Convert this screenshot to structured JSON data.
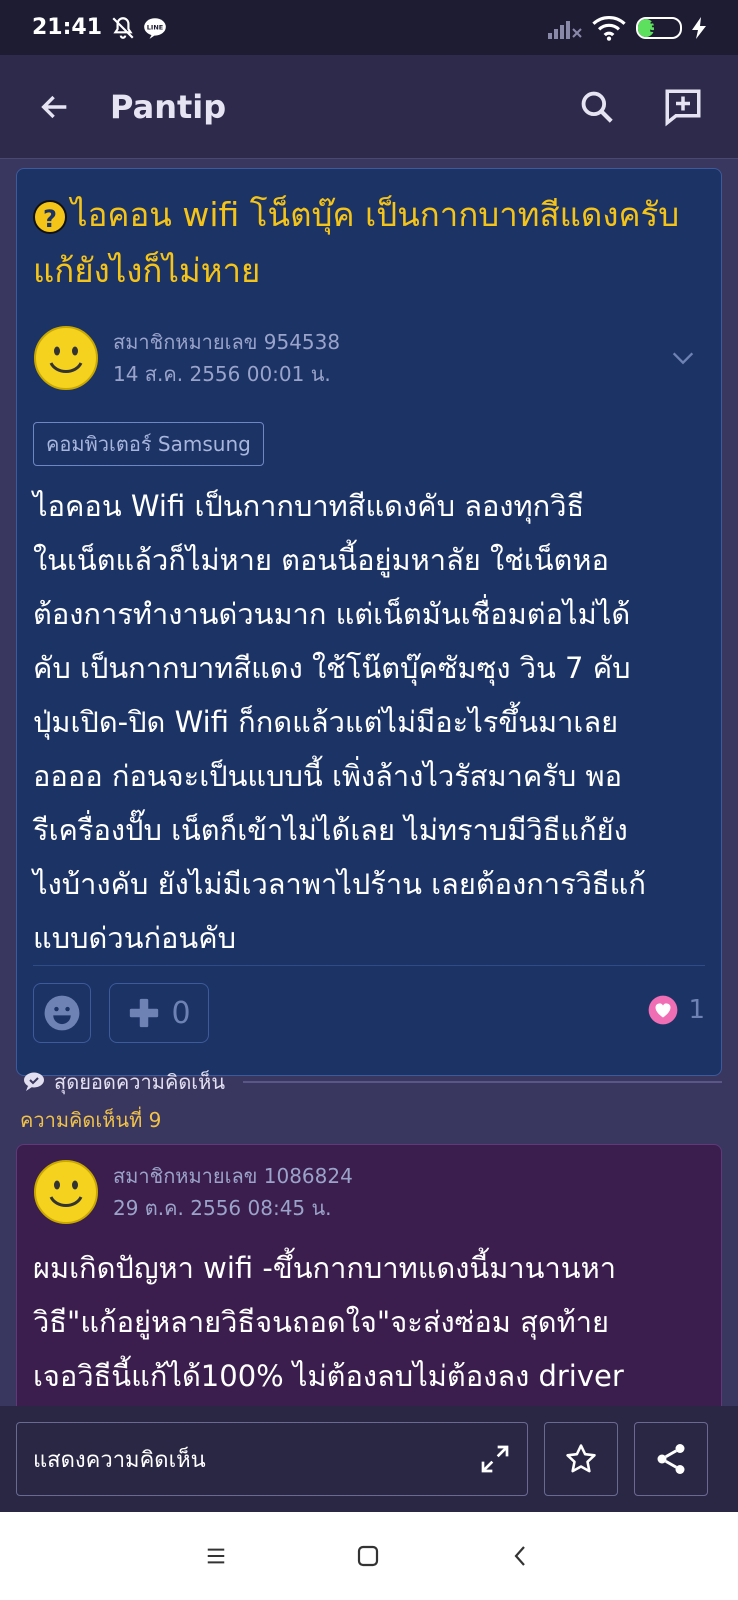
{
  "status_bar": {
    "time": "21:41",
    "battery": "37",
    "battery_level": 0.37,
    "icons": [
      "bell-off-icon",
      "line-icon",
      "signal-icon",
      "wifi-icon",
      "battery-icon",
      "charging-icon"
    ]
  },
  "app_bar": {
    "title": "Pantip",
    "back_icon": "arrow-left-icon",
    "actions": [
      "search-icon",
      "new-topic-icon"
    ]
  },
  "topic": {
    "title": "ไอคอน wifi โน็ตบุ๊ค เป็นกากบาทสีแดงครับ แก้ยังไงก็ไม่หาย",
    "author": "สมาชิกหมายเลข 954538",
    "date": "14 ส.ค. 2556 00:01 น.",
    "tag": "คอมพิวเตอร์ Samsung",
    "body_lines": [
      "ไอคอน Wifi เป็นกากบาทสีแดงคับ ลองทุกวิธี",
      "ในเน็ตแล้วก็ไม่หาย ตอนนี้อยู่มหาลัย ใช่เน็ตหอ",
      "ต้องการทำงานด่วนมาก แต่เน็ตมันเชื่อมต่อไม่ได้",
      "คับ เป็นกากบาทสีแดง ใช้โน๊ตบุ๊คซัมซุง วิน 7 คับ",
      "ปุ่มเปิด-ปิด Wifi ก็กดแล้วแต่ไม่มีอะไรขึ้นมาเลย",
      "ออออ ก่อนจะเป็นแบบนี้ เพิ่งล้างไวรัสมาครับ พอ",
      "รีเครื่องปั๊บ เน็ตก็เข้าไม่ได้เลย ไม่ทราบมีวิธีแก้ยัง",
      "ไงบ้างคับ ยังไม่มีเวลาพาไปร้าน เลยต้องการวิธีแก้",
      "แบบด่วนก่อนคับ"
    ],
    "plus_count": "0",
    "heart_count": "1"
  },
  "comments_section": {
    "best_label": "สุดยอดความคิดเห็น",
    "comment_number": "ความคิดเห็นที่ 9"
  },
  "comment": {
    "author": "สมาชิกหมายเลข 1086824",
    "date": "29 ต.ค. 2556 08:45 น.",
    "lines": [
      "ผมเกิดปัญหา wifi -ขึ้นกากบาทแดงนี้มานานหา",
      "วิธี\"แก้อยู่หลายวิธีจนถอดใจ\"จะส่งซ่อม สุดท้าย",
      "เจอวิธีนี้แก้ได้100% ไม่ต้องลบไม่ต้องลง driver"
    ]
  },
  "bottom_bar": {
    "comment_placeholder": "แสดงความคิดเห็น"
  },
  "colors": {
    "background": "#39365f",
    "topic_card": "#1c3366",
    "comment_card": "#3b1e4d",
    "title": "#f5c418",
    "comment_number": "#f0c24a"
  }
}
